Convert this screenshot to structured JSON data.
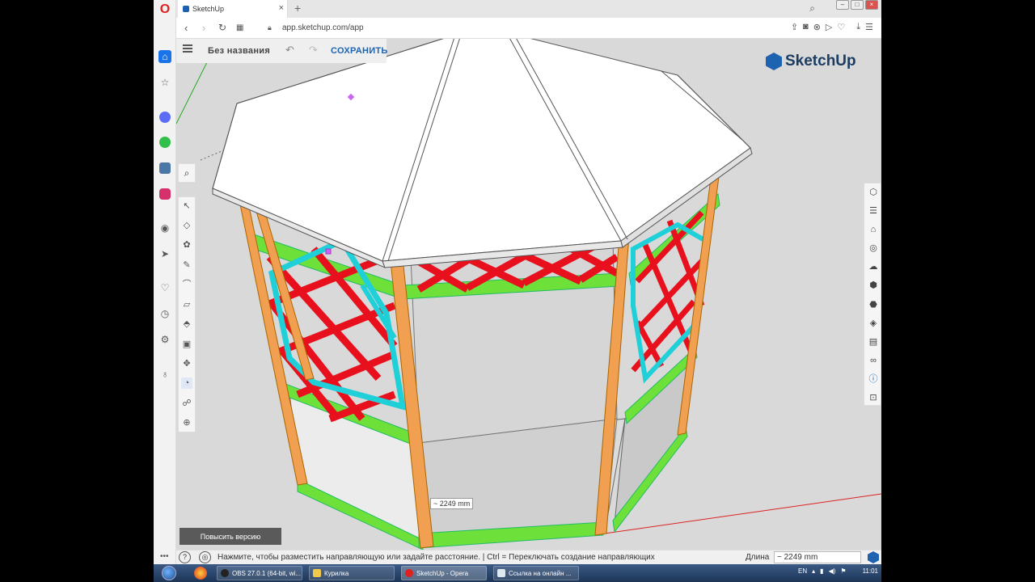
{
  "browser": {
    "tab_title": "SketchUp",
    "tab_close": "×",
    "new_tab": "+",
    "url": "app.sketchup.com/app",
    "window_buttons": [
      "–",
      "□",
      "×"
    ]
  },
  "sketchup": {
    "file_title": "Без названия",
    "save_label": "СОХРАНИТЬ",
    "logo_text": "SketchUp",
    "dimension_label": "~ 2249 mm",
    "upgrade_label": "Повысить версию"
  },
  "statusbar": {
    "hint": "Нажмите, чтобы разместить направляющую или задайте расстояние. | Ctrl = Переключать создание направляющих",
    "length_label": "Длина",
    "length_value": "~ 2249 mm"
  },
  "taskbar": {
    "items": [
      "OBS 27.0.1 (64-bit, wi...",
      "Курилка",
      "SketchUp - Opera",
      "Ссылка на онлайн ..."
    ],
    "lang": "EN",
    "clock": "11:01"
  },
  "colors": {
    "accent": "#1e63b0",
    "lattice_red": "#e8101c",
    "frame_cyan": "#1fd0d8",
    "rail_green": "#6ee03a",
    "post_orange": "#f0a050"
  }
}
